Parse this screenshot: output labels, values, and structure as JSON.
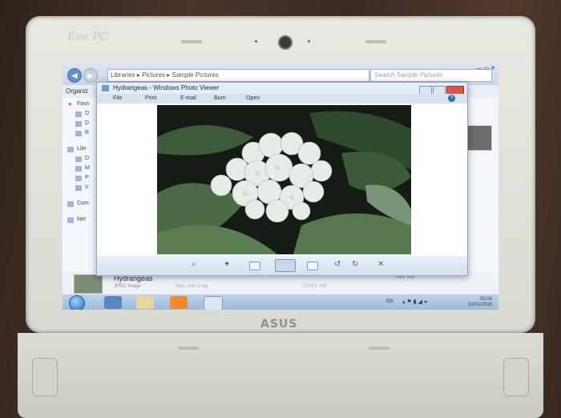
{
  "device": {
    "brand": "Eee PC",
    "maker": "ASUS"
  },
  "explorer": {
    "breadcrumb": "Libraries ▸ Pictures ▸ Sample Pictures",
    "search_placeholder": "Search Sample Pictures",
    "toolbar_label": "Organiz",
    "sidebar": [
      {
        "label": "Favo"
      },
      {
        "label": "D"
      },
      {
        "label": "D"
      },
      {
        "label": "R"
      },
      {
        "label": "Libr"
      },
      {
        "label": "D"
      },
      {
        "label": "M"
      },
      {
        "label": "P"
      },
      {
        "label": "V"
      },
      {
        "label": "Com"
      },
      {
        "label": "Net"
      }
    ],
    "details": {
      "name": "Hydrangeas",
      "type": "JPEG image",
      "tags": "Tags: Add a tag",
      "size": "581 KB",
      "dimensions": "1024 x 768"
    }
  },
  "viewer": {
    "title": "Hydrangeas - Windows Photo Viewer",
    "menu": [
      "File",
      "Print",
      "E-mail",
      "Burn",
      "Open"
    ],
    "help": "?"
  },
  "taskbar": {
    "language": "EN",
    "time": "00:06",
    "date": "01/01/2010"
  },
  "colors": {
    "explorer_bar": "#c6d6ea",
    "taskbar": "#9bb9d8",
    "bezel": "#e2e2da"
  }
}
